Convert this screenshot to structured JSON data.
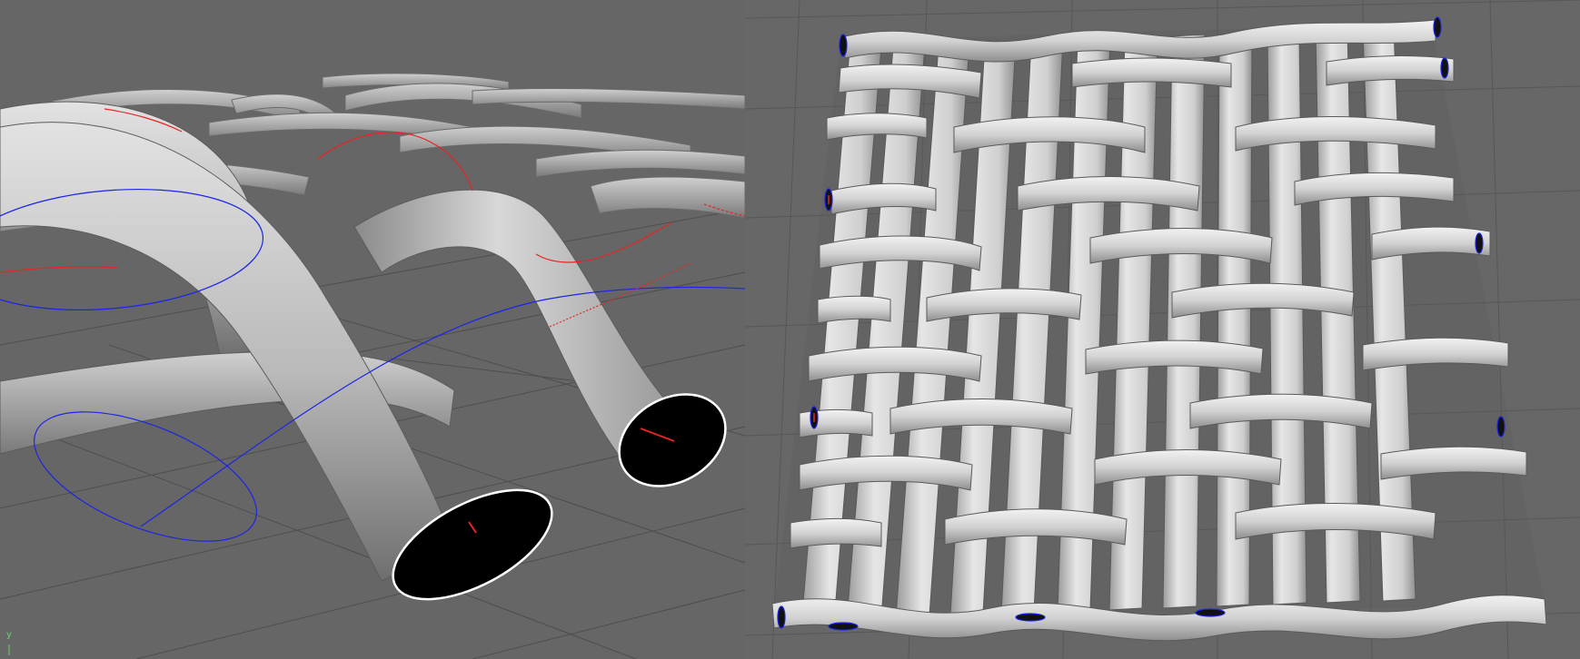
{
  "viewports": {
    "left": {
      "background": "#666666",
      "axis_label": "y"
    },
    "right": {
      "background": "#676767"
    }
  },
  "colors": {
    "tube_light": "#d6d6d6",
    "tube_dark": "#8d8d8d",
    "grid": "#525252",
    "curve_blue": "#1b25e6",
    "curve_red": "#e82424",
    "selection": "#ffffff"
  }
}
